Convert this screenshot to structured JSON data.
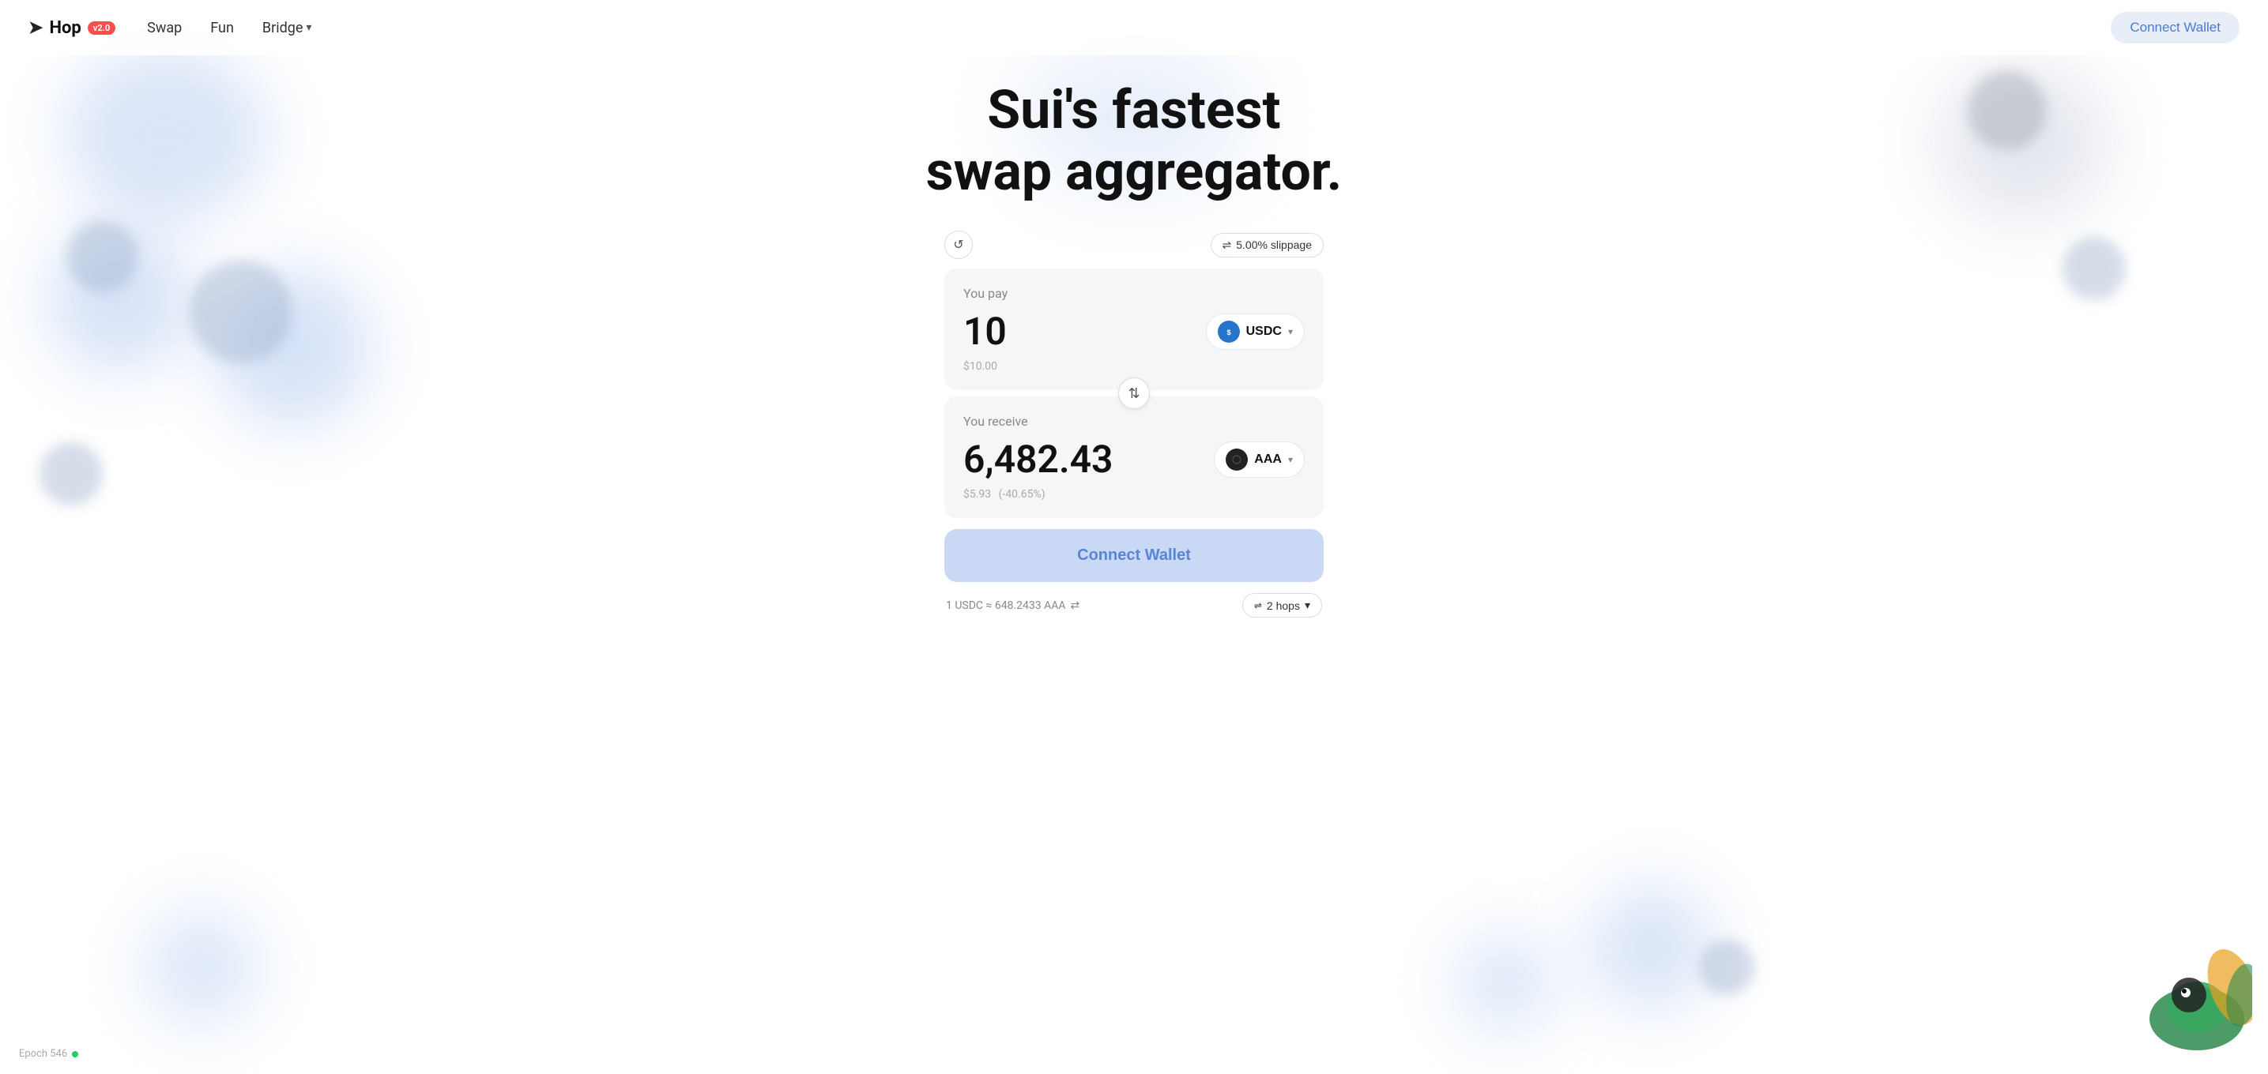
{
  "nav": {
    "logo_text": "Hop",
    "logo_version": "v2.0",
    "links": [
      {
        "label": "Swap",
        "id": "swap"
      },
      {
        "label": "Fun",
        "id": "fun"
      },
      {
        "label": "Bridge",
        "id": "bridge",
        "has_dropdown": true
      }
    ],
    "connect_wallet_label": "Connect Wallet"
  },
  "hero": {
    "title_line1": "Sui's fastest",
    "title_line2": "swap aggregator."
  },
  "swap": {
    "refresh_icon": "↺",
    "slippage_icon": "⇌",
    "slippage_label": "5.00% slippage",
    "you_pay_label": "You pay",
    "pay_amount": "10",
    "pay_usd": "$10.00",
    "pay_token": "USDC",
    "you_receive_label": "You receive",
    "receive_amount": "6,482.43",
    "receive_usd": "$5.93",
    "receive_usd_change": "(-40.65%)",
    "receive_token": "AAA",
    "swap_direction_icon": "⇅",
    "connect_wallet_label": "Connect Wallet",
    "rate_label": "1 USDC ≈ 648.2433 AAA",
    "rate_swap_icon": "⇄",
    "hops_icon": "⇌",
    "hops_label": "2 hops",
    "hops_chevron": "▾"
  },
  "footer": {
    "epoch_label": "Epoch 546",
    "epoch_dot_color": "#22cc66"
  }
}
